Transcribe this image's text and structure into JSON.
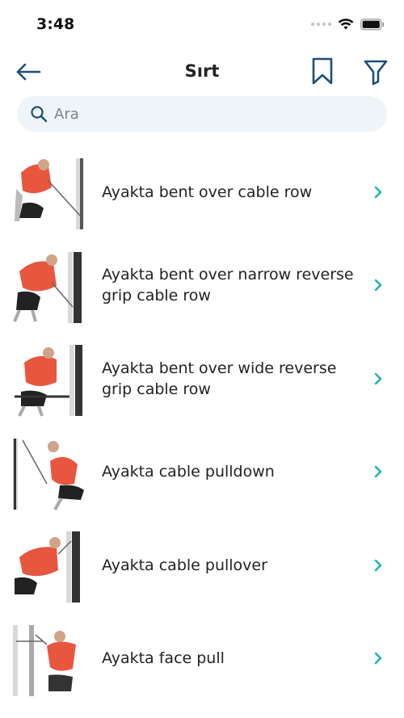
{
  "status": {
    "time": "3:48"
  },
  "header": {
    "title": "Sırt"
  },
  "search": {
    "placeholder": "Ara"
  },
  "colors": {
    "accent": "#1f4e79",
    "chevron": "#16b3b3",
    "muscle": "#e8563f",
    "search_bg": "#eef4f7"
  },
  "icons": [
    "back-arrow-icon",
    "bookmark-icon",
    "filter-icon",
    "search-icon",
    "chevron-right-icon",
    "wifi-icon",
    "battery-icon"
  ],
  "exercises": [
    {
      "title": "Ayakta bent over cable row"
    },
    {
      "title": "Ayakta bent over narrow reverse grip cable row"
    },
    {
      "title": "Ayakta bent over wide reverse grip cable row"
    },
    {
      "title": "Ayakta cable pulldown"
    },
    {
      "title": "Ayakta cable pullover"
    },
    {
      "title": "Ayakta face pull"
    }
  ]
}
